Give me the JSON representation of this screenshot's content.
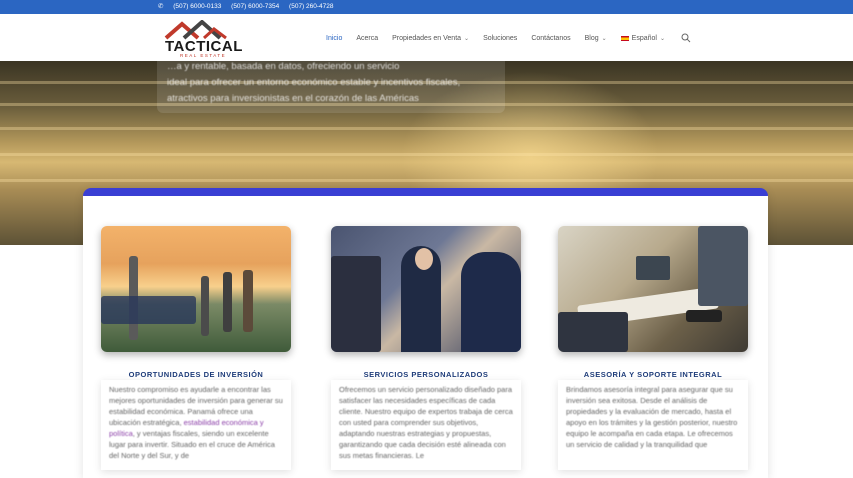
{
  "topbar": {
    "phones": [
      "(507) 6000-0133",
      "(507) 6000-7354",
      "(507) 260-4728"
    ]
  },
  "logo": {
    "brand": "TACTICAL",
    "tagline": "REAL ESTATE"
  },
  "nav": {
    "items": [
      {
        "label": "Inicio",
        "active": true,
        "dropdown": false
      },
      {
        "label": "Acerca",
        "active": false,
        "dropdown": false
      },
      {
        "label": "Propiedades en Venta",
        "active": false,
        "dropdown": true
      },
      {
        "label": "Soluciones",
        "active": false,
        "dropdown": false
      },
      {
        "label": "Contáctanos",
        "active": false,
        "dropdown": false
      },
      {
        "label": "Blog",
        "active": false,
        "dropdown": true
      }
    ],
    "language": "Español"
  },
  "hero": {
    "caption_lines": [
      "…a y rentable, basada en datos, ofreciendo un servicio",
      "ideal para ofrecer un entorno económico estable y incentivos fiscales,",
      "atractivos para inversionistas en el corazón de las Américas"
    ]
  },
  "cards": [
    {
      "title": "OPORTUNIDADES DE INVERSIÓN",
      "text_before": "Nuestro compromiso es ayudarle a encontrar las mejores oportunidades de inversión para generar su estabilidad económica. Panamá ofrece una ubicación estratégica,",
      "link": "estabilidad económica y política",
      "text_after": ", y ventajas fiscales, siendo un excelente lugar para invertir. Situado en el cruce de América del Norte y del Sur, y de"
    },
    {
      "title": "SERVICIOS PERSONALIZADOS",
      "text_before": "Ofrecemos un servicio personalizado diseñado para satisfacer las necesidades específicas de cada cliente. Nuestro equipo de expertos trabaja de cerca con usted para comprender sus objetivos, adaptando nuestras estrategias y propuestas, garantizando que cada decisión esté alineada con sus metas financieras. Le",
      "link": "",
      "text_after": ""
    },
    {
      "title": "ASESORÍA Y SOPORTE INTEGRAL",
      "text_before": "Brindamos asesoría integral para asegurar que su inversión sea exitosa. Desde el análisis de propiedades y la evaluación de mercado, hasta el apoyo en los trámites y la gestión posterior, nuestro equipo le acompaña en cada etapa. Le ofrecemos un servicio de calidad y la tranquilidad que",
      "link": "",
      "text_after": ""
    }
  ],
  "colors": {
    "topbar": "#2b66c2",
    "accent": "#3a3fd4",
    "card_title": "#1f3d7a",
    "nav_active": "#2b66c2"
  }
}
